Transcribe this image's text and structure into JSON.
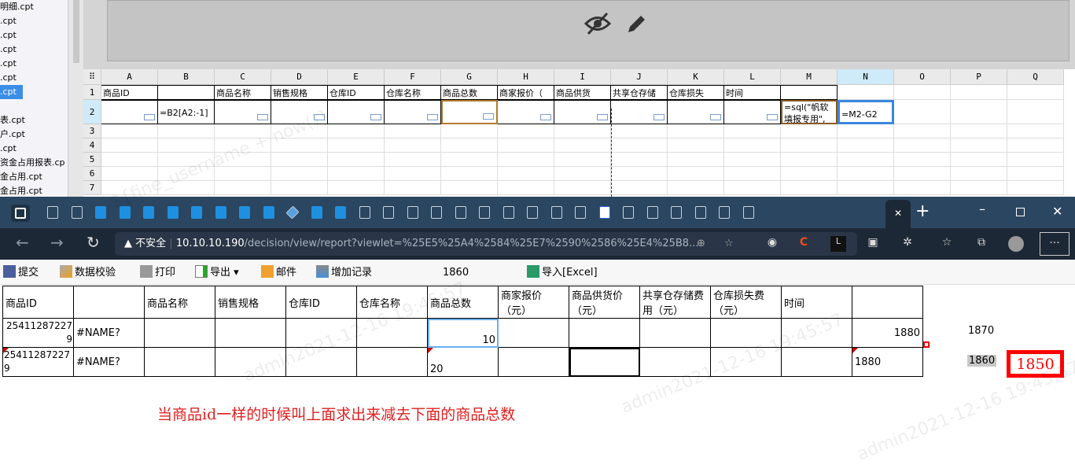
{
  "sidebar": {
    "files": [
      "明细.cpt",
      ".cpt",
      ".cpt",
      ".cpt",
      ".cpt",
      ".cpt",
      ".cpt",
      "表.cpt",
      "户.cpt",
      ".cpt",
      "资金占用报表.cp",
      "金占用.cpt",
      "金占用.cpt"
    ],
    "selected_index": 6
  },
  "designer": {
    "columns": [
      "A",
      "B",
      "C",
      "D",
      "E",
      "F",
      "G",
      "H",
      "I",
      "J",
      "K",
      "L",
      "M",
      "N",
      "O",
      "P",
      "Q"
    ],
    "rows": [
      "1",
      "2",
      "3",
      "4",
      "5",
      "6",
      "7"
    ],
    "row1": [
      "商品ID",
      "",
      "商品名称",
      "销售规格",
      "仓库ID",
      "仓库名称",
      "商品总数",
      "商家报价（",
      "商品供货",
      "共享仓存储",
      "仓库损失",
      "时间",
      "",
      ""
    ],
    "b2": "=B2[A2:-1]",
    "m2": "=sql(\"帆软填报专用\",",
    "n2": "=M2-G2",
    "active_column": "N"
  },
  "browser": {
    "security": "不安全",
    "url_host": "10.10.10.190",
    "url_path": "/decision/view/report?viewlet=%25E5%25A4%2584%25E7%2590%2586%25E4%25B8...",
    "ext_c": "C",
    "ext_l": "L"
  },
  "toolbar": {
    "submit": "提交",
    "validate": "数据校验",
    "print": "打印",
    "export": "导出",
    "mail": "邮件",
    "add_record": "增加记录",
    "value": "1860",
    "import": "导入[Excel]"
  },
  "report": {
    "headers": [
      "商品ID",
      "",
      "商品名称",
      "销售规格",
      "仓库ID",
      "仓库名称",
      "商品总数",
      "商家报价（元）",
      "商品供货价（元）",
      "共享仓存储费用（元）",
      "仓库损失费（元）",
      "时间",
      ""
    ],
    "rows": [
      {
        "id": "254112872279",
        "b": "#NAME?",
        "total": "10",
        "n": "1880",
        "outside": "1870"
      },
      {
        "id": "254112872279",
        "b": "#NAME?",
        "total": "20",
        "n": "1880",
        "outside": "1860",
        "highlight": "1850"
      }
    ]
  },
  "note": "当商品id一样的时候叫上面求出来减去下面的商品总数",
  "watermark": "admin2021-12-16 19:45:57",
  "designer_watermark": "${fine_username + now()}"
}
